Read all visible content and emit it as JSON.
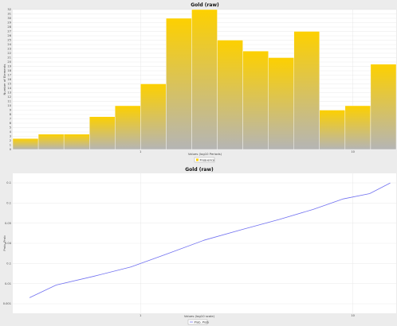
{
  "colors": {
    "panel_bg": "#ececec",
    "plot_bg": "#ffffff",
    "grid": "#dcdcdc",
    "bar_top": "#fdd000",
    "bar_bottom": "#b5b5b5",
    "bar_stroke": "#ffffff",
    "line": "#7070f0",
    "line_axis": "#c8c8ff"
  },
  "chart_data": [
    {
      "type": "bar",
      "title": "Gold (raw)",
      "xlabel": "Values (log10 Periods)",
      "ylabel": "Number of Elements",
      "legend": [
        "Frequency"
      ],
      "legend_position": "bottom-center",
      "grid": true,
      "x_scale": "log",
      "xlim": [
        0.25,
        16
      ],
      "x_ticks": [
        "1",
        "10"
      ],
      "ylim": [
        0,
        32
      ],
      "y_ticks": [
        "0",
        "1",
        "2",
        "3",
        "4",
        "5",
        "6",
        "7",
        "8",
        "9",
        "10",
        "11",
        "12",
        "13",
        "14",
        "15",
        "16",
        "17",
        "18",
        "19",
        "20",
        "21",
        "22",
        "23",
        "24",
        "25",
        "26",
        "27",
        "28",
        "29",
        "30",
        "31",
        "32"
      ],
      "series": [
        {
          "values": [
            2.5,
            3.5,
            3.5,
            7.5,
            10,
            15,
            30,
            32,
            25,
            22.5,
            21,
            27,
            9,
            10,
            19.5
          ]
        }
      ]
    },
    {
      "type": "line",
      "title": "Gold (raw)",
      "xlabel": "Values (log10 scale)",
      "ylabel": "Prob. Prob",
      "legend": [
        "Prob. Prob"
      ],
      "legend_position": "bottom-center",
      "grid": true,
      "x_scale": "log",
      "y_scale": "log",
      "xlim": [
        0.25,
        16
      ],
      "x_ticks": [
        "1",
        "10"
      ],
      "ylim": [
        0.0008,
        0.12
      ],
      "y_ticks": [
        "0.001",
        "0.01",
        "0.1",
        "0.04",
        "0.05",
        "0.1",
        "0.1"
      ],
      "series": [
        {
          "name": "Prob. Prob",
          "x": [
            0.3,
            0.4,
            0.6,
            0.9,
            1.3,
            2,
            3,
            4.5,
            6.5,
            9,
            12,
            15
          ],
          "values": [
            0.0014,
            0.0022,
            0.003,
            0.0042,
            0.0065,
            0.011,
            0.016,
            0.023,
            0.033,
            0.048,
            0.058,
            0.085
          ]
        }
      ]
    }
  ]
}
